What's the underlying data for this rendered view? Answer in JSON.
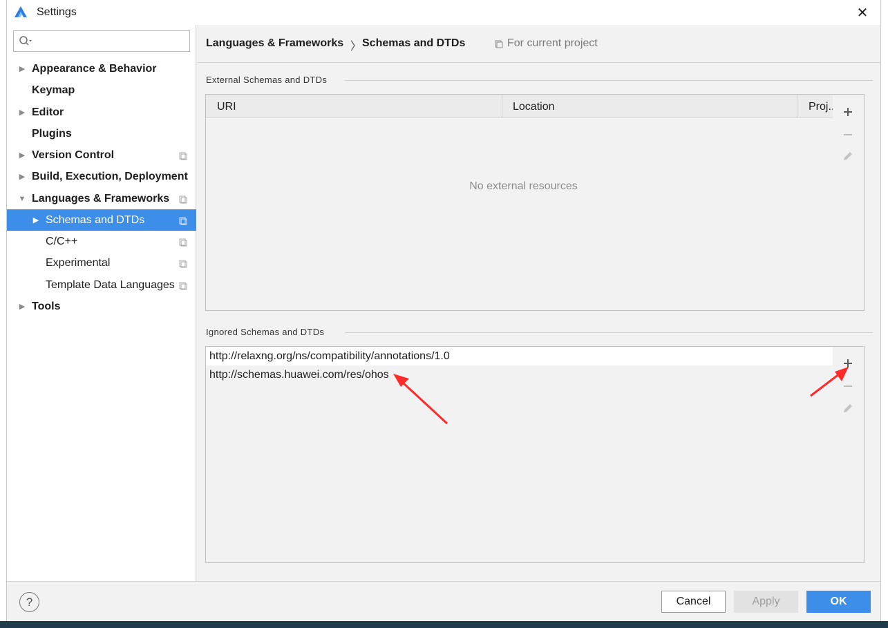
{
  "window": {
    "title": "Settings",
    "app_icon": "devstudio-logo-icon",
    "close_icon": "close-icon"
  },
  "sidebar": {
    "search_placeholder": "",
    "items": [
      {
        "label": "Appearance & Behavior",
        "level": 0,
        "expandable": true,
        "expanded": false,
        "bold": true,
        "project_scope": false
      },
      {
        "label": "Keymap",
        "level": 0,
        "expandable": false,
        "bold": true,
        "project_scope": false
      },
      {
        "label": "Editor",
        "level": 0,
        "expandable": true,
        "expanded": false,
        "bold": true,
        "project_scope": false
      },
      {
        "label": "Plugins",
        "level": 0,
        "expandable": false,
        "bold": true,
        "project_scope": false
      },
      {
        "label": "Version Control",
        "level": 0,
        "expandable": true,
        "expanded": false,
        "bold": true,
        "project_scope": true
      },
      {
        "label": "Build, Execution, Deployment",
        "level": 0,
        "expandable": true,
        "expanded": false,
        "bold": true,
        "project_scope": false
      },
      {
        "label": "Languages & Frameworks",
        "level": 0,
        "expandable": true,
        "expanded": true,
        "bold": true,
        "project_scope": true
      },
      {
        "label": "Schemas and DTDs",
        "level": 1,
        "expandable": true,
        "expanded": false,
        "selected": true,
        "project_scope": true
      },
      {
        "label": "C/C++",
        "level": 1,
        "expandable": false,
        "project_scope": true
      },
      {
        "label": "Experimental",
        "level": 1,
        "expandable": false,
        "project_scope": true
      },
      {
        "label": "Template Data Languages",
        "level": 1,
        "expandable": false,
        "project_scope": true
      },
      {
        "label": "Tools",
        "level": 0,
        "expandable": true,
        "expanded": false,
        "bold": true,
        "project_scope": false
      }
    ]
  },
  "breadcrumb": {
    "parent": "Languages & Frameworks",
    "separator": "〉",
    "current": "Schemas and DTDs",
    "scope": "For current project"
  },
  "external": {
    "title": "External Schemas and DTDs",
    "columns": [
      "URI",
      "Location",
      "Proj..."
    ],
    "empty_text": "No external resources",
    "toolbar": [
      "add-icon",
      "remove-icon",
      "edit-icon"
    ]
  },
  "ignored": {
    "title": "Ignored Schemas and DTDs",
    "rows": [
      "http://relaxng.org/ns/compatibility/annotations/1.0",
      "http://schemas.huawei.com/res/ohos"
    ],
    "toolbar": [
      "add-icon",
      "remove-icon",
      "edit-icon"
    ]
  },
  "footer": {
    "help": "?",
    "cancel": "Cancel",
    "apply": "Apply",
    "ok": "OK"
  },
  "colors": {
    "accent": "#3d8ee8",
    "annotation_arrow": "#ff2a2a"
  }
}
